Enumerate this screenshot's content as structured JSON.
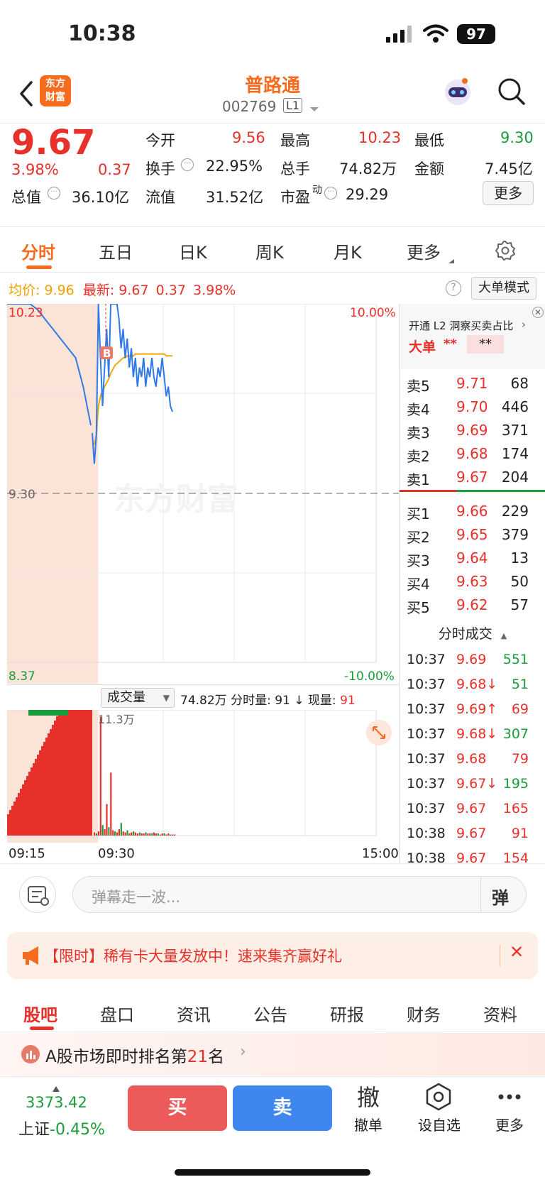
{
  "status": {
    "time": "10:38",
    "battery": "97"
  },
  "header": {
    "stock_name": "普路通",
    "stock_code": "002769",
    "level": "L1",
    "logo_text_1": "东方",
    "logo_text_2": "财富"
  },
  "quote": {
    "price": "9.67",
    "change_pct": "3.98%",
    "change": "0.37",
    "open_label": "今开",
    "open": "9.56",
    "high_label": "最高",
    "high": "10.23",
    "low_label": "最低",
    "low": "9.30",
    "turnover_label": "换手",
    "turnover": "22.95%",
    "volume_label": "总手",
    "volume": "74.82万",
    "amount_label": "金额",
    "amount": "7.45亿",
    "mktcap_label": "总值",
    "mktcap": "36.10亿",
    "float_label": "流值",
    "float": "31.52亿",
    "pe_label": "市盈",
    "pe_sup": "动",
    "pe": "29.29",
    "more_button": "更多"
  },
  "tabs": {
    "items": [
      "分时",
      "五日",
      "日K",
      "周K",
      "月K",
      "更多"
    ],
    "active": 0
  },
  "chart_info": {
    "avg_label": "均价:",
    "avg": "9.96",
    "latest_label": "最新:",
    "latest": "9.67",
    "latest_chg": "0.37",
    "latest_pct": "3.98%",
    "big_order_mode": "大单模式",
    "y_top": "10.23",
    "y_mid": "9.30",
    "y_bottom": "8.37",
    "pct_top": "10.00%",
    "pct_bottom": "-10.00%",
    "watermark": "东方财富",
    "buy_marker": "B",
    "vol_label": "成交量",
    "vol_total": "74.82万",
    "vol_period_label": "分时量:",
    "vol_period": "91",
    "vol_now_label": "现量:",
    "vol_now": "91",
    "vol_max": "11.3万",
    "time_start": "09:15",
    "time_open": "09:30",
    "time_end": "15:00"
  },
  "chart_data": [
    {
      "type": "line",
      "title": "",
      "x": [
        "09:25",
        "09:30",
        "09:31",
        "09:32",
        "09:33",
        "09:34",
        "09:35",
        "09:36",
        "09:37",
        "09:38",
        "09:39",
        "09:40",
        "09:41",
        "09:42",
        "09:43",
        "09:44",
        "09:45",
        "09:46",
        "09:47",
        "09:48",
        "09:49",
        "09:50",
        "09:51",
        "09:52",
        "09:53",
        "09:54",
        "09:55",
        "09:56",
        "09:57",
        "09:58",
        "09:59",
        "10:00",
        "10:05",
        "10:10",
        "10:15",
        "10:20",
        "10:25",
        "10:30",
        "10:35",
        "10:38"
      ],
      "series": [
        {
          "values": [
            9.56,
            9.4,
            9.55,
            10.23,
            9.95,
            9.7,
            9.9,
            10.1,
            9.85,
            10.23,
            10.23,
            10.23,
            10.23,
            10.15,
            10.0,
            10.1,
            9.95,
            10.05,
            9.9,
            10.0,
            9.85,
            9.95,
            9.8,
            9.9,
            9.85,
            9.95,
            9.8,
            9.9,
            9.85,
            9.95,
            9.85,
            9.8,
            9.9,
            9.85,
            9.95,
            9.85,
            9.75,
            9.8,
            9.7,
            9.67
          ]
        },
        {
          "values": [
            9.56,
            9.5,
            9.55,
            9.7,
            9.75,
            9.78,
            9.8,
            9.82,
            9.84,
            9.87,
            9.89,
            9.91,
            9.92,
            9.93,
            9.94,
            9.95,
            9.95,
            9.96,
            9.96,
            9.96,
            9.96,
            9.97,
            9.97,
            9.97,
            9.97,
            9.97,
            9.97,
            9.97,
            9.97,
            9.97,
            9.97,
            9.97,
            9.97,
            9.97,
            9.97,
            9.97,
            9.96,
            9.96,
            9.96,
            9.96
          ]
        }
      ],
      "ylim": [
        8.37,
        10.23
      ],
      "pre_open_line": [
        10.23,
        10.23,
        10.23,
        10.23,
        10.2,
        10.15,
        10.1,
        10.05,
        10.0,
        9.95,
        9.8,
        9.6
      ]
    },
    {
      "type": "bar",
      "title": "",
      "values": [
        3,
        2,
        4,
        113,
        10,
        6,
        30,
        8,
        60,
        5,
        4,
        3,
        6,
        12,
        4,
        3,
        5,
        2,
        3,
        4,
        3,
        2,
        3,
        2,
        2,
        3,
        2,
        2,
        2,
        3,
        2,
        2,
        1,
        2,
        2,
        1,
        2,
        1,
        1,
        1
      ],
      "ylim": [
        0,
        113
      ]
    }
  ],
  "orderbook": {
    "promo": "开通 L2 洞察买卖占比",
    "big_label": "大单",
    "big_val_1": "**",
    "big_val_2": "**",
    "asks": [
      {
        "label": "卖5",
        "price": "9.71",
        "vol": "68"
      },
      {
        "label": "卖4",
        "price": "9.70",
        "vol": "446"
      },
      {
        "label": "卖3",
        "price": "9.69",
        "vol": "371"
      },
      {
        "label": "卖2",
        "price": "9.68",
        "vol": "174"
      },
      {
        "label": "卖1",
        "price": "9.67",
        "vol": "204"
      }
    ],
    "bids": [
      {
        "label": "买1",
        "price": "9.66",
        "vol": "229"
      },
      {
        "label": "买2",
        "price": "9.65",
        "vol": "379"
      },
      {
        "label": "买3",
        "price": "9.64",
        "vol": "13"
      },
      {
        "label": "买4",
        "price": "9.63",
        "vol": "50"
      },
      {
        "label": "买5",
        "price": "9.62",
        "vol": "57"
      }
    ],
    "ticks_title": "分时成交",
    "ticks": [
      {
        "time": "10:37",
        "price": "9.69",
        "arrow": "",
        "vol": "551",
        "vol_color": "green"
      },
      {
        "time": "10:37",
        "price": "9.68↓",
        "arrow": "down",
        "vol": "51",
        "vol_color": "green"
      },
      {
        "time": "10:37",
        "price": "9.69↑",
        "arrow": "up",
        "vol": "69",
        "vol_color": "red"
      },
      {
        "time": "10:37",
        "price": "9.68↓",
        "arrow": "down",
        "vol": "307",
        "vol_color": "green"
      },
      {
        "time": "10:37",
        "price": "9.68",
        "arrow": "",
        "vol": "79",
        "vol_color": "red"
      },
      {
        "time": "10:37",
        "price": "9.67↓",
        "arrow": "down",
        "vol": "195",
        "vol_color": "green"
      },
      {
        "time": "10:37",
        "price": "9.67",
        "arrow": "",
        "vol": "165",
        "vol_color": "red"
      },
      {
        "time": "10:38",
        "price": "9.67",
        "arrow": "",
        "vol": "91",
        "vol_color": "red"
      },
      {
        "time": "10:38",
        "price": "9.67",
        "arrow": "",
        "vol": "154",
        "vol_color": "red"
      }
    ]
  },
  "comment": {
    "placeholder": "弹幕走一波...",
    "danmaku_button": "弹"
  },
  "banner": {
    "text": "【限时】稀有卡大量发放中！速来集齐赢好礼"
  },
  "section_tabs": {
    "items": [
      "股吧",
      "盘口",
      "资讯",
      "公告",
      "研报",
      "财务",
      "资料"
    ],
    "active": 0
  },
  "ranking": {
    "prefix": "A股市场即时排名第",
    "rank": "21",
    "suffix": "名"
  },
  "bottom": {
    "index_value": "3373.42",
    "index_name": "上证",
    "index_change": "-0.45%",
    "buy": "买",
    "sell": "卖",
    "cancel_icon_text": "撤",
    "cancel_label": "撤单",
    "watch_label": "设自选",
    "more_label": "更多"
  },
  "colors": {
    "red": "#e8302a",
    "green": "#1a9c3a",
    "orange": "#f56c1e",
    "blue": "#2f79e8",
    "avg_line": "#f0a800",
    "preopen_fill": "#fbe3d8"
  }
}
